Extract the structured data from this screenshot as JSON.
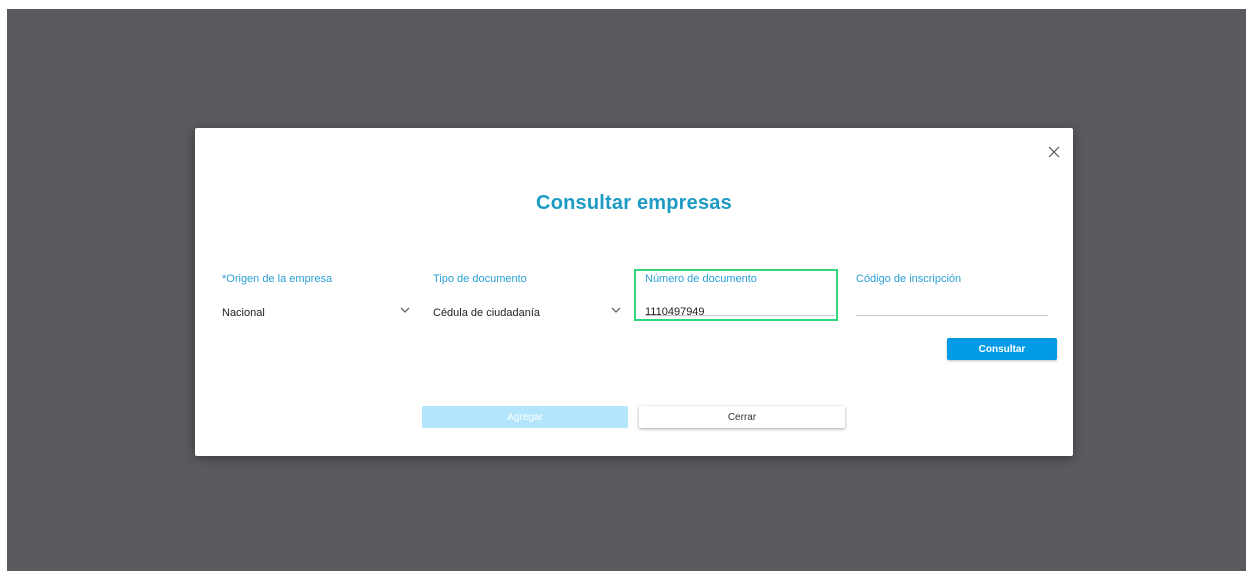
{
  "dialog": {
    "title": "Consultar empresas",
    "close_icon": "close-icon"
  },
  "fields": {
    "origen": {
      "label": "*Origen de la empresa",
      "value": "Nacional",
      "icon": "chevron-down-icon"
    },
    "tipo_documento": {
      "label": "Tipo de documento",
      "value": "Cédula de ciudadanía",
      "icon": "chevron-down-icon"
    },
    "numero_documento": {
      "label": "Número de documento",
      "value": "1110497949"
    },
    "codigo_inscripcion": {
      "label": "Código de inscripción",
      "value": ""
    }
  },
  "buttons": {
    "consultar": "Consultar",
    "agregar": "Agregar",
    "cerrar": "Cerrar"
  },
  "colors": {
    "backdrop": "#59595e",
    "accent": "#039be5",
    "title": "#1e9bc4",
    "label": "#2a9fd6",
    "highlight": "#2fd67c",
    "disabled_button": "#b3e5fc"
  }
}
